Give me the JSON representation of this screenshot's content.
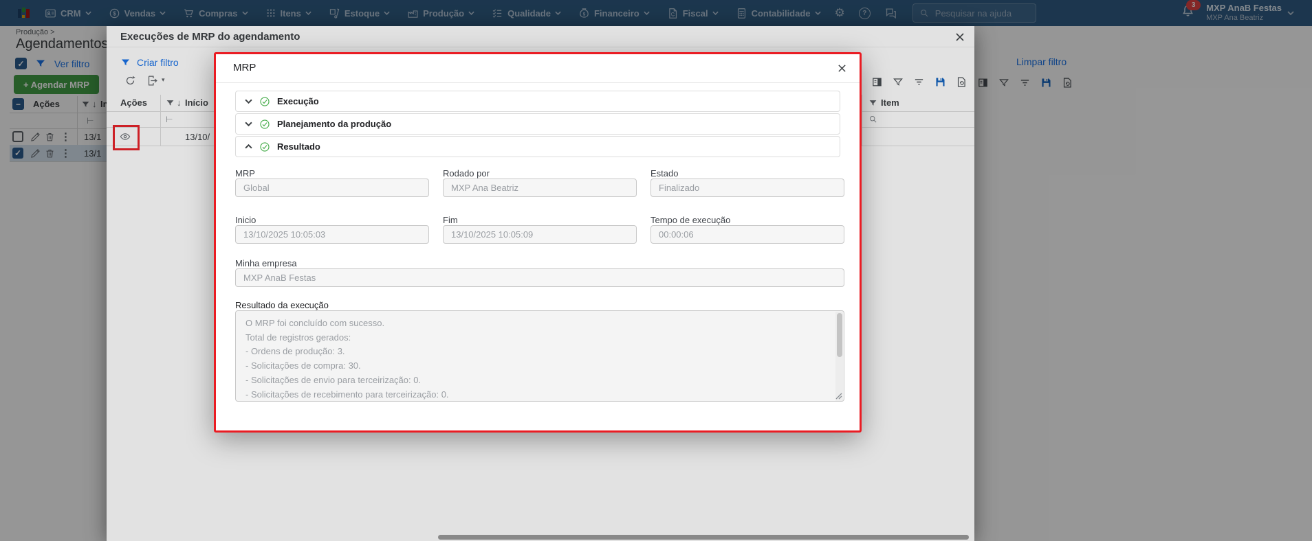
{
  "navbar": {
    "menus": [
      "CRM",
      "Vendas",
      "Compras",
      "Itens",
      "Estoque",
      "Produção",
      "Qualidade",
      "Financeiro",
      "Fiscal",
      "Contabilidade"
    ],
    "search_placeholder": "Pesquisar na ajuda",
    "notification_count": "3",
    "user_name": "MXP AnaB Festas",
    "user_subtitle": "MXP Ana Beatriz"
  },
  "page": {
    "breadcrumb": "Produção >",
    "title": "Agendamentos de",
    "ver_filtro_label": "Ver filtro",
    "agendar_mrp_label": "+ Agendar MRP",
    "limpar_filtro_label": "Limpar filtro",
    "table": {
      "col_actions": "Ações",
      "col_start": "Início",
      "rows": [
        {
          "start": "13/1",
          "selected": false
        },
        {
          "start": "13/1",
          "selected": true
        }
      ]
    }
  },
  "executions_modal": {
    "title": "Execuções de MRP do agendamento",
    "criar_filtro_label": "Criar filtro",
    "table": {
      "col_actions": "Ações",
      "col_start": "Início",
      "col_item": "Item",
      "row": {
        "start": "13/10/"
      }
    }
  },
  "mrp_modal": {
    "title": "MRP",
    "sections": [
      {
        "label": "Execução",
        "state": "collapsed"
      },
      {
        "label": "Planejamento da produção",
        "state": "collapsed"
      },
      {
        "label": "Resultado",
        "state": "expanded"
      }
    ],
    "fields": {
      "mrp": {
        "label": "MRP",
        "value": "Global"
      },
      "rodado_por": {
        "label": "Rodado por",
        "value": "MXP Ana Beatriz"
      },
      "estado": {
        "label": "Estado",
        "value": "Finalizado"
      },
      "inicio": {
        "label": "Inicio",
        "value": "13/10/2025 10:05:03"
      },
      "fim": {
        "label": "Fim",
        "value": "13/10/2025 10:05:09"
      },
      "tempo_execucao": {
        "label": "Tempo de execução",
        "value": "00:00:06"
      },
      "minha_empresa": {
        "label": "Minha empresa",
        "value": "MXP AnaB Festas"
      }
    },
    "result": {
      "label": "Resultado da execução",
      "lines": [
        "O MRP foi concluído com sucesso.",
        "Total de registros gerados:",
        "- Ordens de produção: 3.",
        "- Solicitações de compra: 30.",
        "- Solicitações de envio para terceirização: 0.",
        "- Solicitações de recebimento para terceirização: 0."
      ]
    }
  },
  "glyphs": {
    "sort_down": "↓",
    "kebab": "⋮",
    "caret": "▾",
    "col_resize": "⊢",
    "gear": "⚙",
    "help": "?",
    "check": "✓",
    "minus": "−"
  },
  "colors": {
    "accent_blue": "#1a73e8",
    "green": "#43a047",
    "highlight_red": "#e8252b",
    "navbar": "#305d85",
    "floppy_blue": "#1565c0",
    "selected_row": "#d8e6f2"
  }
}
